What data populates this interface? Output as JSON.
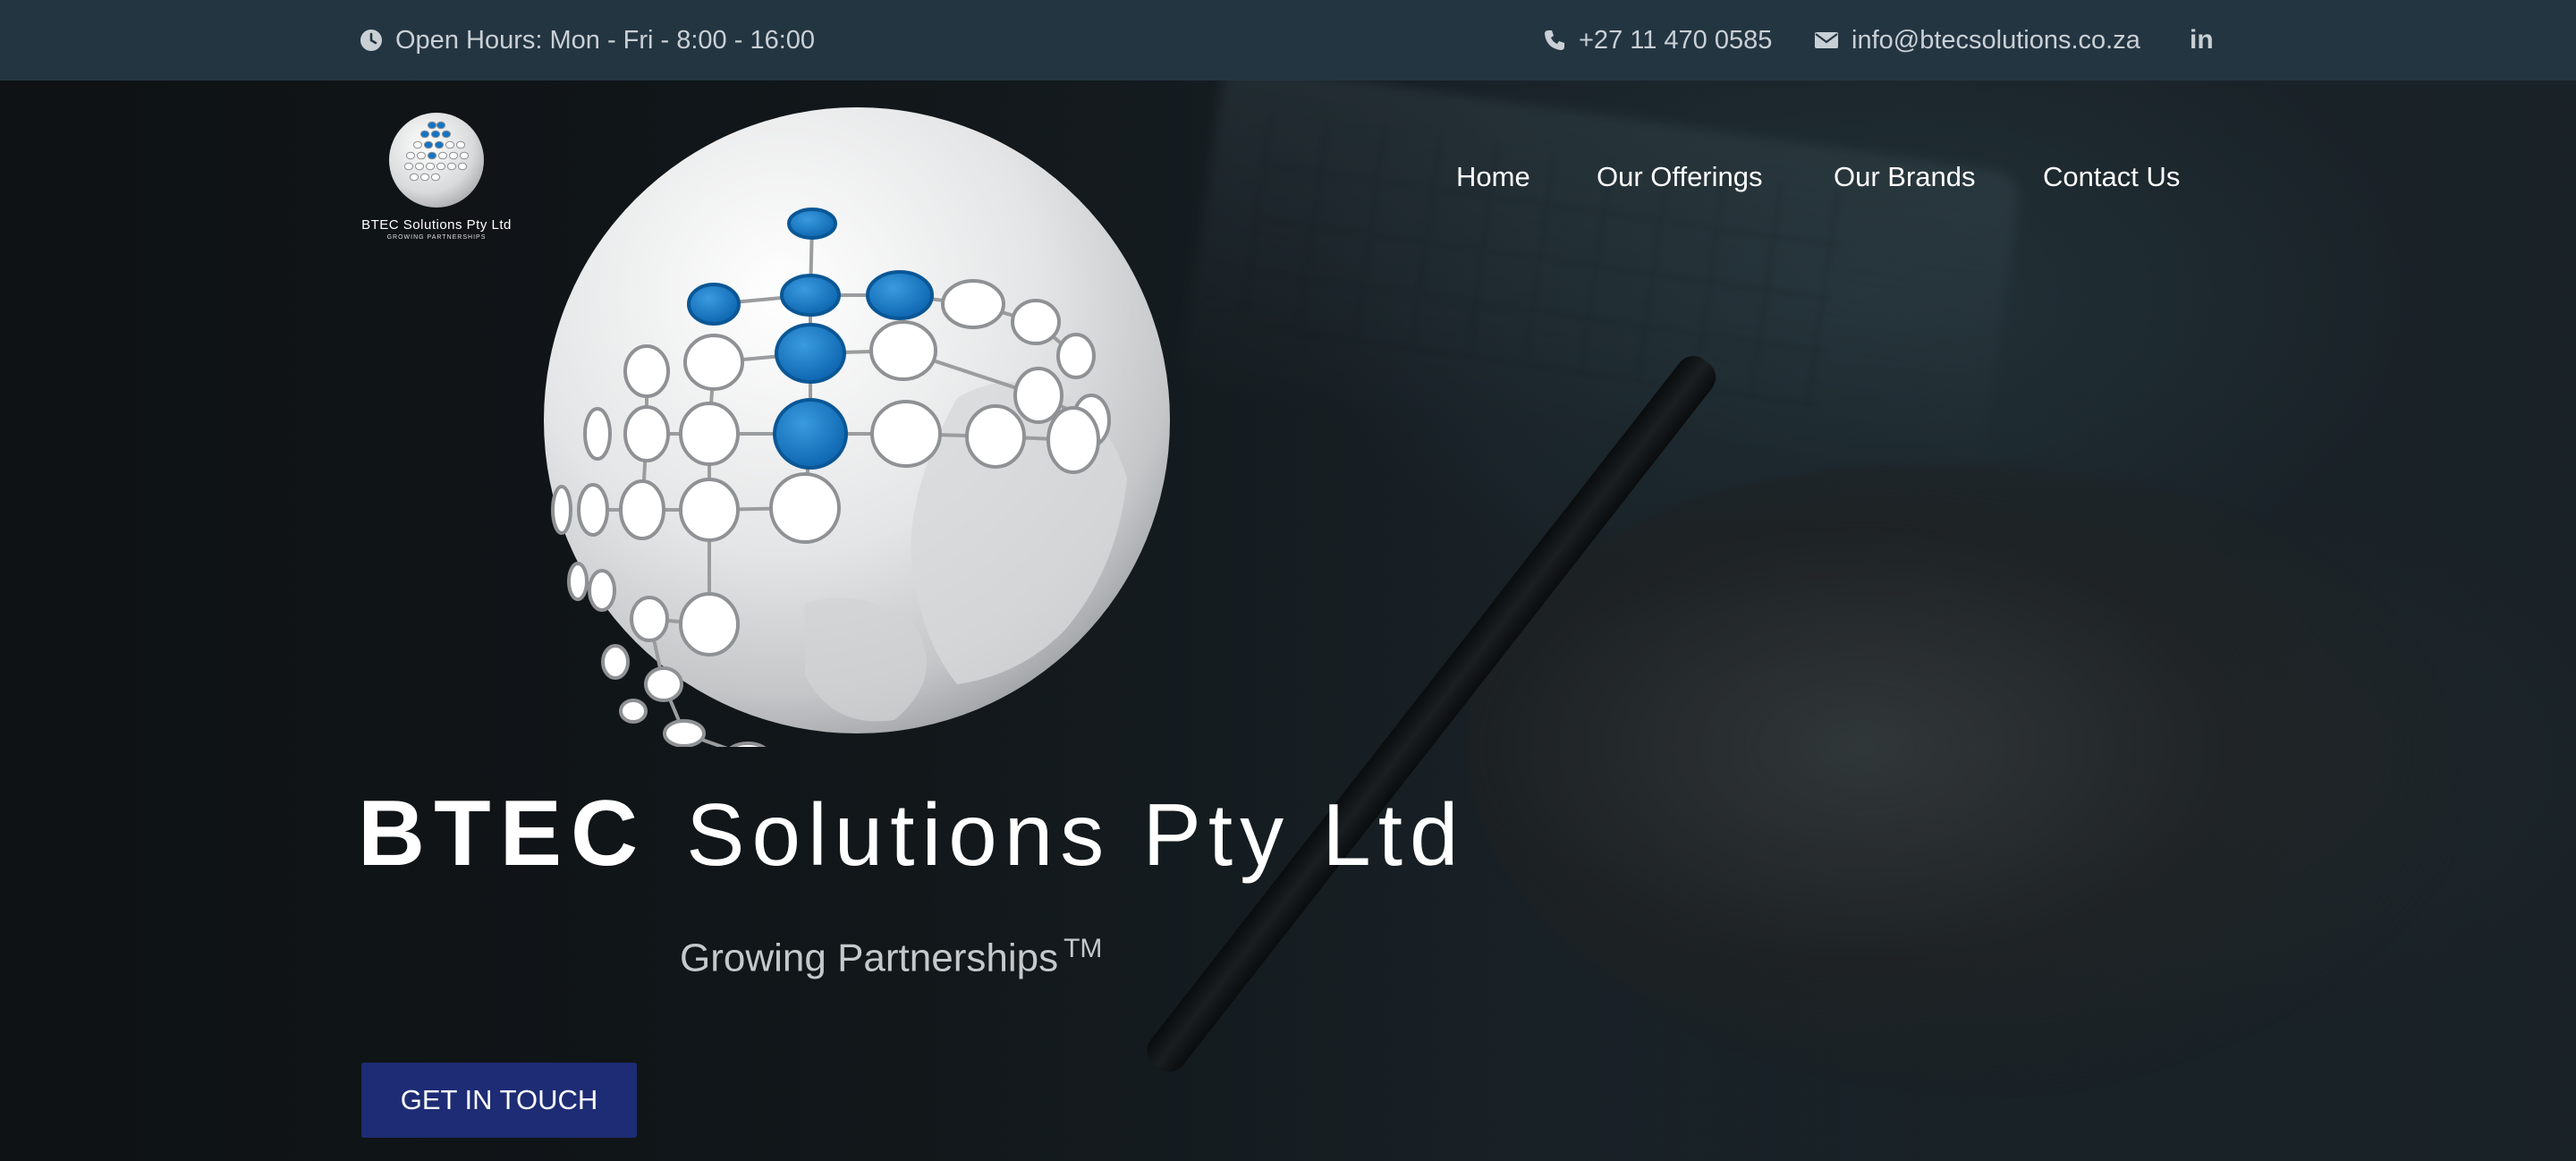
{
  "topbar": {
    "hours": "Open Hours: Mon - Fri - 8:00 - 16:00",
    "phone": "+27 11 470 0585",
    "email": "info@btecsolutions.co.za",
    "linkedin": "in",
    "icons": [
      "clock-icon",
      "phone-icon",
      "envelope-icon",
      "linkedin-icon"
    ]
  },
  "logo": {
    "name": "BTEC Solutions Pty Ltd",
    "tagline": "GROWING PARTNERSHIPS"
  },
  "nav": {
    "items": [
      {
        "label": "Home"
      },
      {
        "label": "Our Offerings"
      },
      {
        "label": "Our Brands"
      },
      {
        "label": "Contact Us"
      }
    ]
  },
  "hero": {
    "brand": "BTEC",
    "rest": "Solutions Pty Ltd",
    "tagline": "Growing Partnerships",
    "tm": "TM",
    "cta": "GET IN TOUCH"
  },
  "colors": {
    "topbar": "#243542",
    "cta": "#1d2c74",
    "globe_accent": "#1475c4"
  }
}
